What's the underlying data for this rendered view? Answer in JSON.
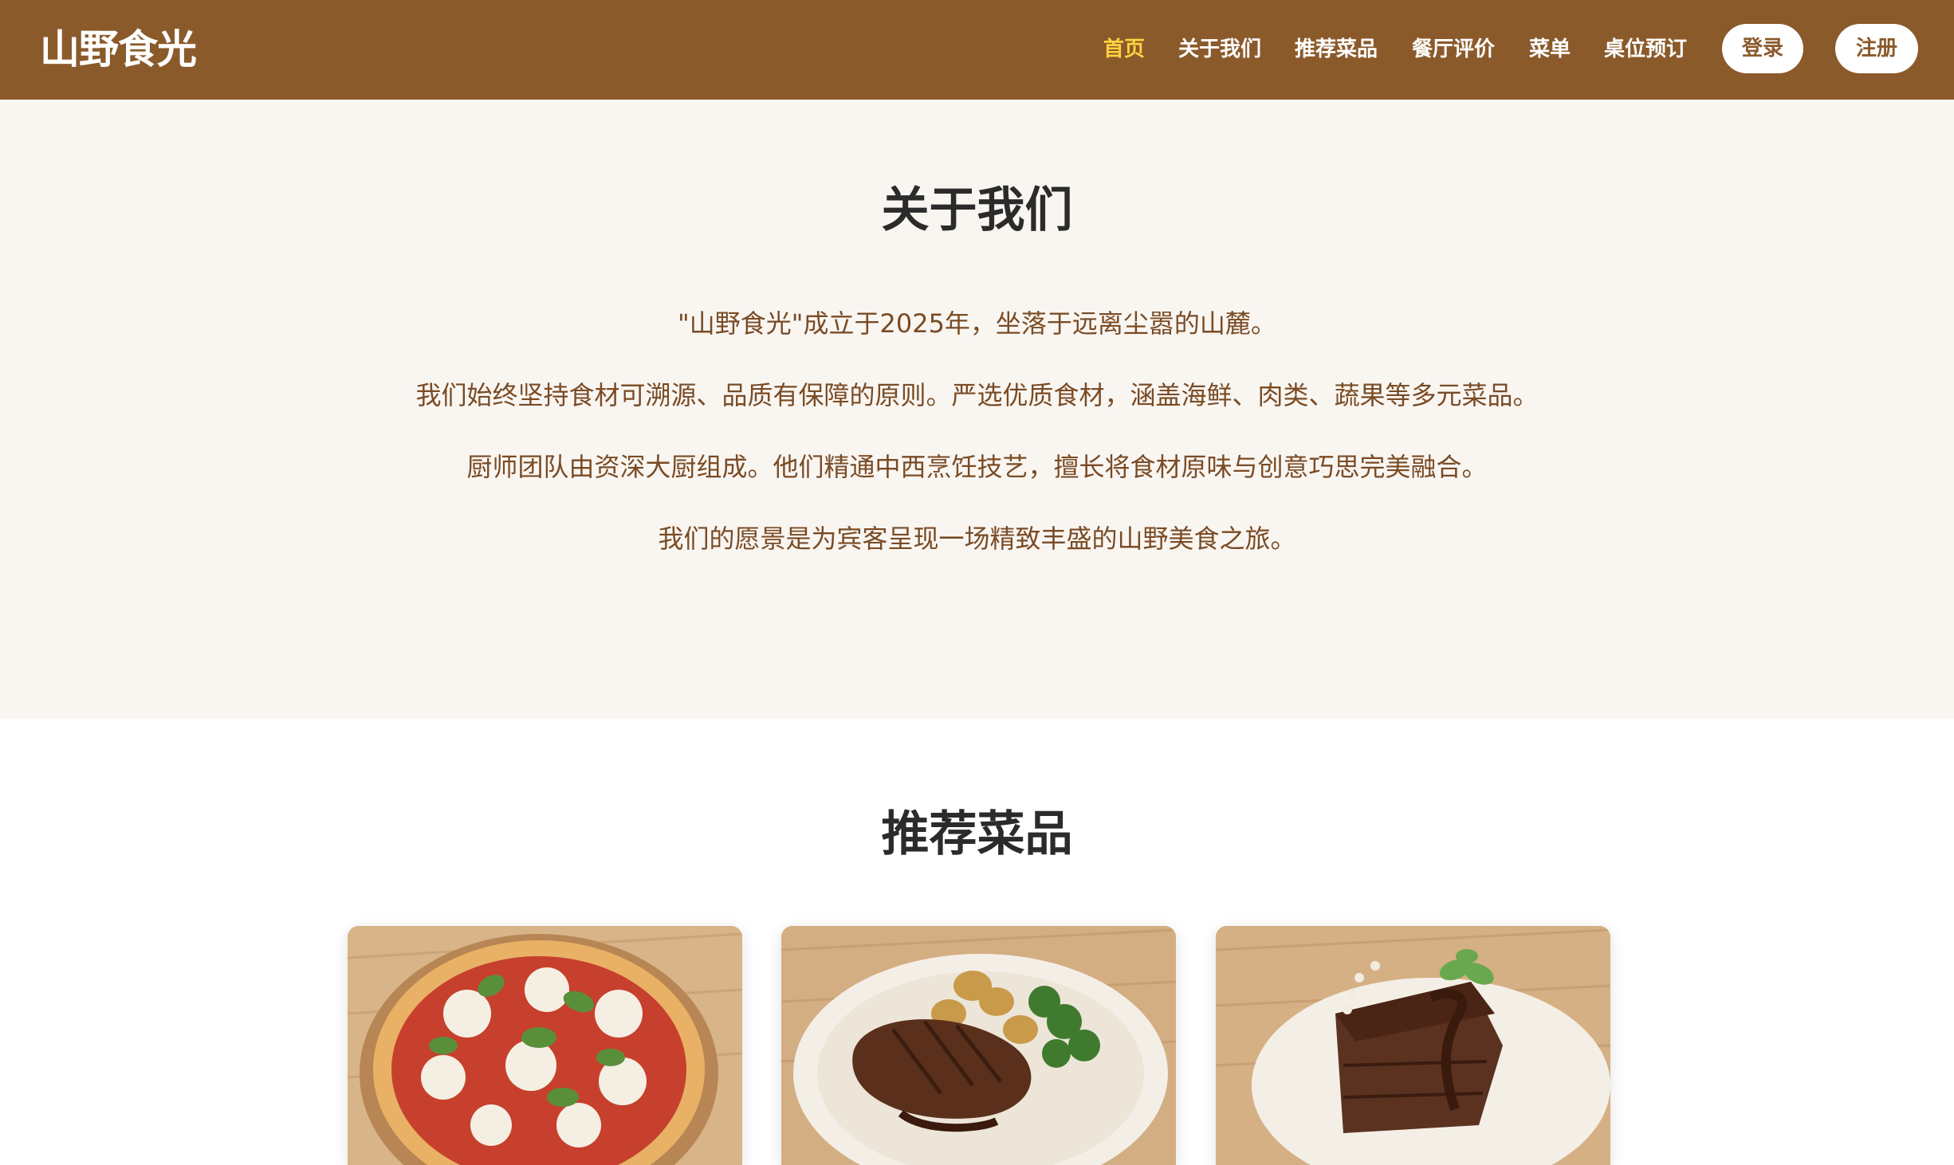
{
  "header": {
    "brand": "山野食光",
    "nav": [
      {
        "label": "首页",
        "active": true
      },
      {
        "label": "关于我们",
        "active": false
      },
      {
        "label": "推荐菜品",
        "active": false
      },
      {
        "label": "餐厅评价",
        "active": false
      },
      {
        "label": "菜单",
        "active": false
      },
      {
        "label": "桌位预订",
        "active": false
      }
    ],
    "login_label": "登录",
    "register_label": "注册"
  },
  "about": {
    "title": "关于我们",
    "paragraphs": [
      "\"山野食光\"成立于2025年，坐落于远离尘嚣的山麓。",
      "我们始终坚持食材可溯源、品质有保障的原则。严选优质食材，涵盖海鲜、肉类、蔬果等多元菜品。",
      "厨师团队由资深大厨组成。他们精通中西烹饪技艺，擅长将食材原味与创意巧思完美融合。",
      "我们的愿景是为宾客呈现一场精致丰盛的山野美食之旅。"
    ]
  },
  "recommended": {
    "title": "推荐菜品",
    "dishes": [
      {
        "image": "margherita-pizza-photo"
      },
      {
        "image": "grilled-steak-photo"
      },
      {
        "image": "chocolate-cake-photo"
      }
    ]
  },
  "colors": {
    "header_bg": "#8b5a2b",
    "nav_active": "#ffd23f",
    "about_bg": "#f9f6f2",
    "about_text": "#7a4b24",
    "title_text": "#2b2b2b"
  }
}
